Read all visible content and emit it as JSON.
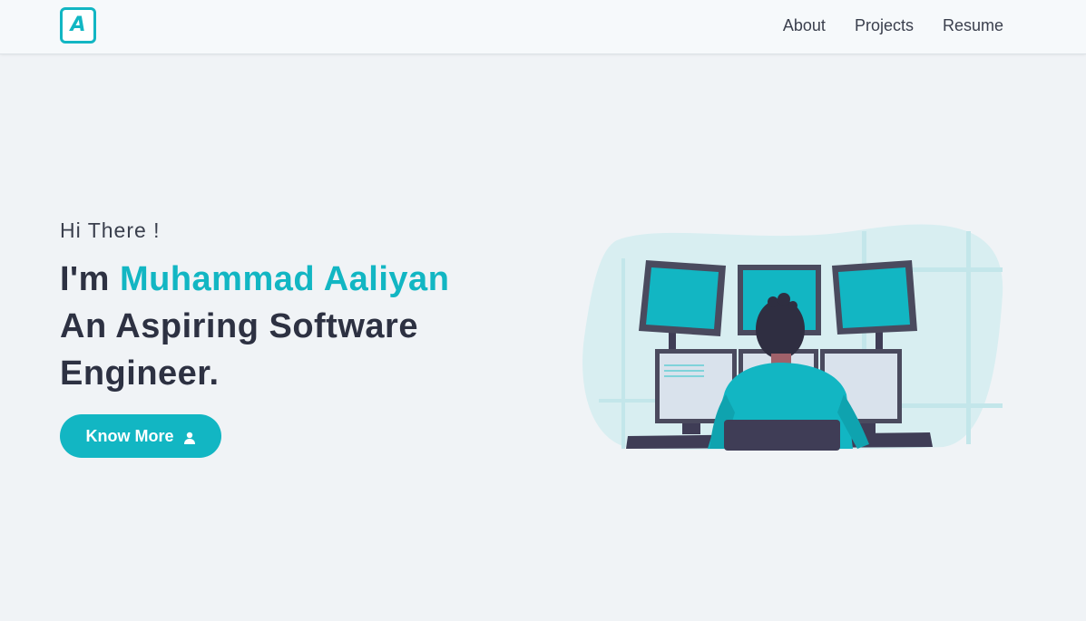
{
  "nav": {
    "logo_letter": "A",
    "links": [
      {
        "label": "About"
      },
      {
        "label": "Projects"
      },
      {
        "label": "Resume"
      }
    ]
  },
  "hero": {
    "greeting": "Hi There !",
    "intro_prefix": "I'm ",
    "name": "Muhammad Aaliyan",
    "tagline_line1": "An Aspiring Software",
    "tagline_line2": "Engineer.",
    "cta_label": "Know More",
    "cta_icon": "user-icon"
  },
  "colors": {
    "accent": "#12b6c3",
    "text_dark": "#2d3142",
    "background": "#f0f3f6"
  },
  "illustration": {
    "icon": "developer-at-monitors-illustration"
  }
}
